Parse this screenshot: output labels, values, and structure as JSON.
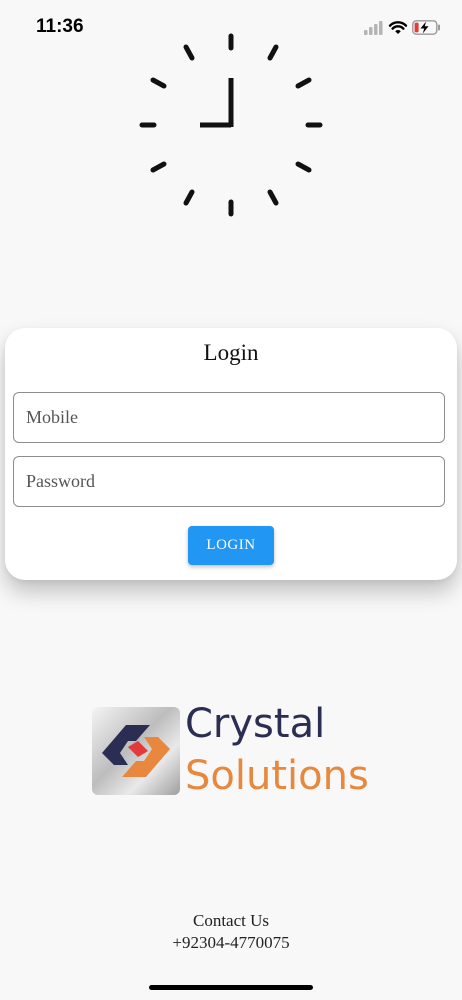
{
  "status_bar": {
    "time": "11:36",
    "signal_icon": "cellular-signal-icon",
    "wifi_icon": "wifi-icon",
    "battery_icon": "battery-charging-icon",
    "battery_level": 0.15
  },
  "loader": {
    "icon": "clock-loader-icon"
  },
  "login_card": {
    "title": "Login",
    "mobile_placeholder": "Mobile",
    "mobile_value": "",
    "password_placeholder": "Password",
    "password_value": "",
    "button_label": "LOGIN",
    "button_color": "#2196f3"
  },
  "logo": {
    "line1": "Crystal",
    "line2": "Solutions",
    "line1_color": "#2b2d53",
    "line2_color": "#e8883f",
    "mark_icon": "crystal-solutions-logo-icon"
  },
  "contact": {
    "label": "Contact Us",
    "phone": "+92304-4770075"
  }
}
